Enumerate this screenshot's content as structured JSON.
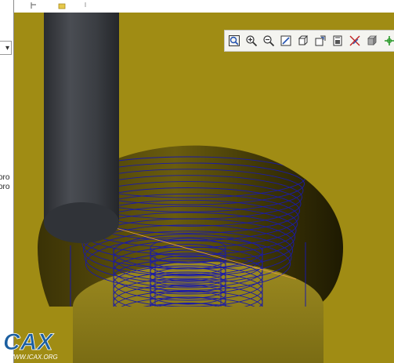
{
  "left_panel": {
    "dropdown_glyph": "▾",
    "text_line_1": "oro",
    "text_line_2": "oro"
  },
  "toolbar": {
    "buttons": [
      {
        "name": "zoom-window-icon"
      },
      {
        "name": "zoom-in-icon"
      },
      {
        "name": "zoom-out-icon"
      },
      {
        "name": "refit-icon"
      },
      {
        "name": "orient-icon"
      },
      {
        "name": "saved-views-icon"
      },
      {
        "name": "layers-icon"
      },
      {
        "name": "display-axes-icon"
      },
      {
        "name": "shade-icon"
      },
      {
        "name": "spin-center-icon"
      }
    ]
  },
  "logo": {
    "main_text": "CAX",
    "sub_text": "WWW.ICAX.ORG"
  },
  "colors": {
    "background": "#a08c14",
    "tool": "#3c3f44",
    "toolpath": "#1a1aa8",
    "pocket_floor": "#8a7a1c",
    "pocket_wall": "#5e5208"
  }
}
